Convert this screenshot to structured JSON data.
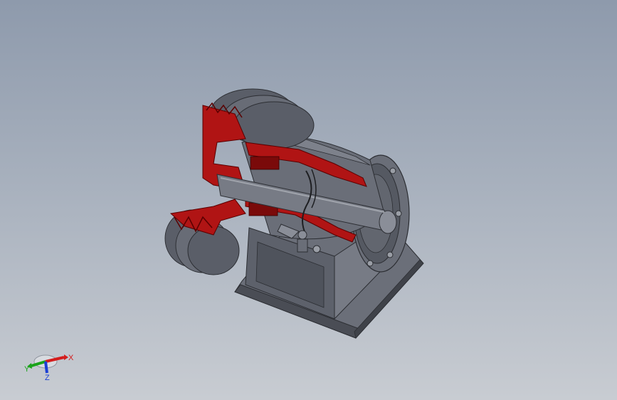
{
  "viewport": {
    "background_top": "#8e9aac",
    "background_bottom": "#c8ccd2"
  },
  "model": {
    "body_color": "#5d616b",
    "body_dark": "#3a3d45",
    "body_light": "#8a8e98",
    "section_color": "#b01414",
    "section_dark": "#7a0a0a"
  },
  "triad": {
    "x_label": "X",
    "y_label": "Y",
    "z_label": "Z",
    "x_color": "#d41c1c",
    "y_color": "#1aa31a",
    "z_color": "#1c3fd4"
  }
}
